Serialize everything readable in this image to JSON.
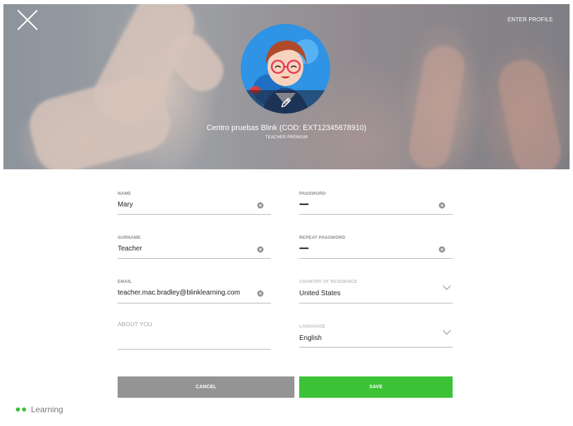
{
  "header": {
    "enter_profile_label": "ENTER PROFILE",
    "centre_name": "Centro pruebas Blink (COD: EXT12345678910)",
    "role": "TEACHER PREMIUM"
  },
  "form": {
    "name": {
      "label": "NAME",
      "value": "Mary"
    },
    "surname": {
      "label": "SURNAME",
      "value": "Teacher"
    },
    "email": {
      "label": "EMAIL",
      "value": "teacher.mac.bradley@blinklearning.com"
    },
    "about": {
      "label": "ABOUT YOU",
      "value": ""
    },
    "password": {
      "label": "PASSWORD",
      "value": "••••••"
    },
    "repeat_password": {
      "label": "REPEAT PASSWORD",
      "value": "••••••"
    },
    "country": {
      "label": "COUNTRY OF RESIDENCE",
      "value": "United States"
    },
    "language": {
      "label": "LANGUAGE",
      "value": "English"
    }
  },
  "actions": {
    "cancel_label": "CANCEL",
    "save_label": "SAVE"
  },
  "brand": {
    "text": "Learning"
  },
  "colors": {
    "accent": "#3cc237",
    "cancel": "#949494"
  }
}
